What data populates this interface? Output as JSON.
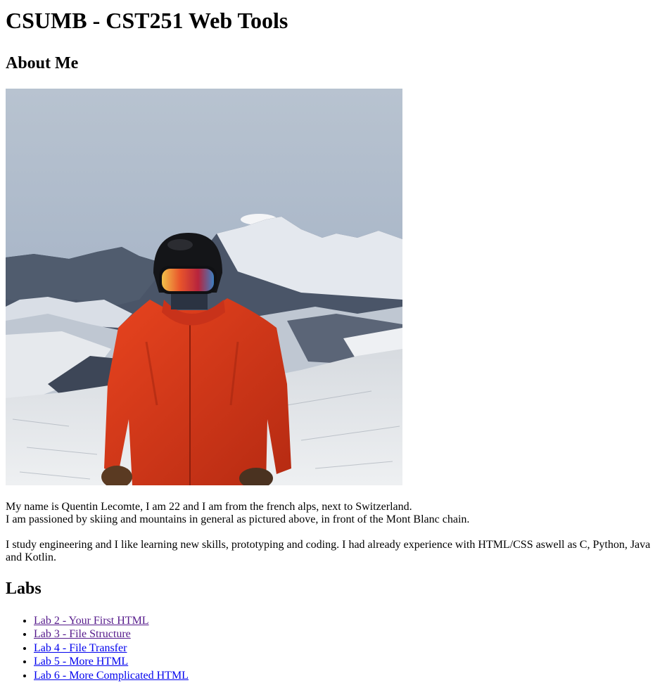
{
  "page": {
    "title": "CSUMB - CST251 Web Tools",
    "about_heading": "About Me",
    "photo_description_icon": "skier-photo",
    "intro_line1": "My name is Quentin Lecomte, I am 22 and I am from the french alps, next to Switzerland.",
    "intro_line2": "I am passioned by skiing and mountains in general as pictured above, in front of the Mont Blanc chain.",
    "study_text": "I study engineering and I like learning new skills, prototyping and coding. I had already experience with HTML/CSS aswell as C, Python, Java and Kotlin.",
    "labs_heading": "Labs",
    "labs": [
      {
        "label": "Lab 2 - Your First HTML",
        "visited": true
      },
      {
        "label": "Lab 3 - File Structure",
        "visited": true
      },
      {
        "label": "Lab 4 - File Transfer",
        "visited": false
      },
      {
        "label": "Lab 5 - More HTML",
        "visited": false
      },
      {
        "label": "Lab 6 - More Complicated HTML",
        "visited": false
      }
    ]
  },
  "colors": {
    "link": "#0000ee",
    "visited_link": "#551a8b",
    "jacket": "#d8361c",
    "sky": "#a9b7c9",
    "snow": "#e9ecef"
  }
}
